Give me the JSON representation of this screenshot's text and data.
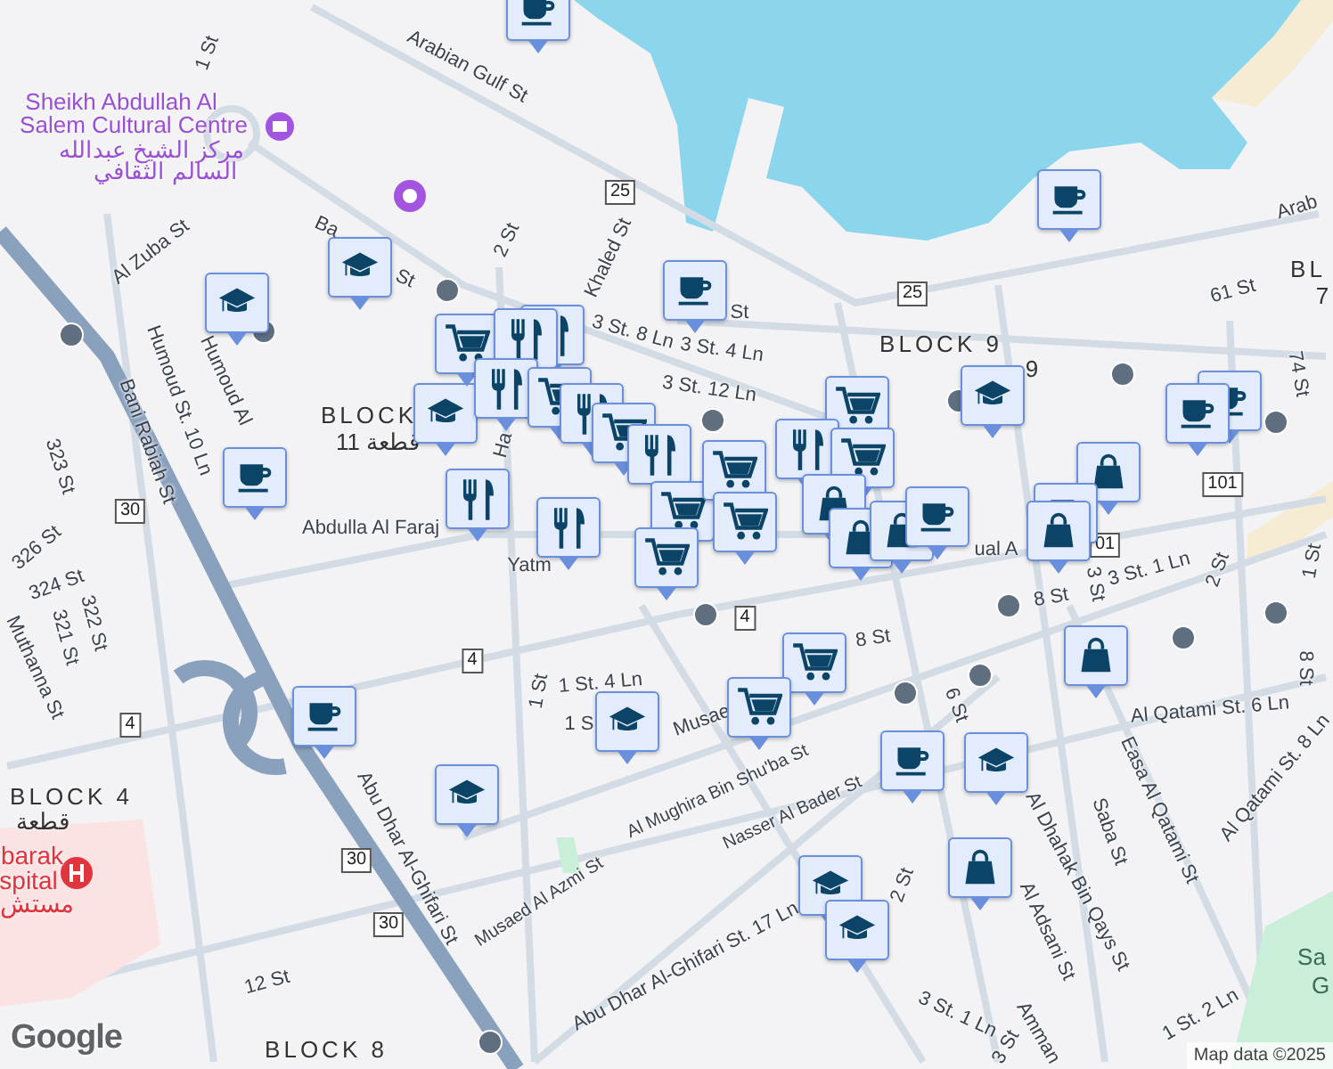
{
  "map": {
    "labels": [
      {
        "text": "Arabian Gulf St",
        "kind": "street"
      },
      {
        "text": "Arab",
        "kind": "street"
      },
      {
        "text": "Sheikh Abdullah Al",
        "kind": "poi"
      },
      {
        "text": "Salem Cultural Centre",
        "kind": "poi"
      },
      {
        "text": "مركز الشيخ عبدالله",
        "kind": "poi"
      },
      {
        "text": "السالم الثقافي",
        "kind": "poi"
      },
      {
        "text": "1 St",
        "kind": "street"
      },
      {
        "text": "25",
        "kind": "shield"
      },
      {
        "text": "2 St",
        "kind": "street"
      },
      {
        "text": "Khaled St",
        "kind": "street"
      },
      {
        "text": "Ba",
        "kind": "street"
      },
      {
        "text": "St",
        "kind": "street"
      },
      {
        "text": "Al Zuba St",
        "kind": "street"
      },
      {
        "text": "Humoud St. 10 Ln",
        "kind": "street"
      },
      {
        "text": "Humoud Al",
        "kind": "street"
      },
      {
        "text": "Bani Rabiah St",
        "kind": "street"
      },
      {
        "text": "323 St",
        "kind": "street"
      },
      {
        "text": "30",
        "kind": "shield"
      },
      {
        "text": "BLOCK",
        "kind": "area"
      },
      {
        "text": "قطعة 11",
        "kind": "area"
      },
      {
        "text": "3 St. 8 Ln",
        "kind": "street"
      },
      {
        "text": "St",
        "kind": "street"
      },
      {
        "text": "3 St. 4 Ln",
        "kind": "street"
      },
      {
        "text": "3 St. 12 Ln",
        "kind": "street"
      },
      {
        "text": "25",
        "kind": "shield"
      },
      {
        "text": "BLOCK 9",
        "kind": "area"
      },
      {
        "text": "9",
        "kind": "area"
      },
      {
        "text": "61 St",
        "kind": "street"
      },
      {
        "text": "BL",
        "kind": "area"
      },
      {
        "text": "7",
        "kind": "area"
      },
      {
        "text": "74 St",
        "kind": "street"
      },
      {
        "text": "101",
        "kind": "shield"
      },
      {
        "text": "01",
        "kind": "shield"
      },
      {
        "text": "Abdulla Al Faraj",
        "kind": "street"
      },
      {
        "text": "Ha",
        "kind": "street"
      },
      {
        "text": "Yatm",
        "kind": "street"
      },
      {
        "text": "ual A",
        "kind": "street"
      },
      {
        "text": "326 St",
        "kind": "street"
      },
      {
        "text": "324 St",
        "kind": "street"
      },
      {
        "text": "322 St",
        "kind": "street"
      },
      {
        "text": "321 St",
        "kind": "street"
      },
      {
        "text": "Muthanna St",
        "kind": "street"
      },
      {
        "text": "4",
        "kind": "shield"
      },
      {
        "text": "4",
        "kind": "shield"
      },
      {
        "text": "4",
        "kind": "shield"
      },
      {
        "text": "1 St",
        "kind": "street"
      },
      {
        "text": "1 St. 4 Ln",
        "kind": "street"
      },
      {
        "text": "1 S",
        "kind": "street"
      },
      {
        "text": "Musae",
        "kind": "street"
      },
      {
        "text": "BLOCK 4",
        "kind": "area"
      },
      {
        "text": "قطعة",
        "kind": "area"
      },
      {
        "text": "barak",
        "kind": "hospital"
      },
      {
        "text": "spital",
        "kind": "hospital"
      },
      {
        "text": "مستش",
        "kind": "hospital"
      },
      {
        "text": "Abu Dhar Al-Ghifari St",
        "kind": "street"
      },
      {
        "text": "Musaed Al Azmi St",
        "kind": "street"
      },
      {
        "text": "Al Mughira Bin Shu'ba St",
        "kind": "street"
      },
      {
        "text": "Nasser Al Bader St",
        "kind": "street"
      },
      {
        "text": "8 St",
        "kind": "street"
      },
      {
        "text": "8 St",
        "kind": "street"
      },
      {
        "text": "3 St",
        "kind": "street"
      },
      {
        "text": "3 St. 1 Ln",
        "kind": "street"
      },
      {
        "text": "2 St",
        "kind": "street"
      },
      {
        "text": "1 St",
        "kind": "street"
      },
      {
        "text": "Al Qatami St. 6 Ln",
        "kind": "street"
      },
      {
        "text": "Easa Al Qatami St",
        "kind": "street"
      },
      {
        "text": "Al Qatami St. 8 Ln",
        "kind": "street"
      },
      {
        "text": "8 St",
        "kind": "street"
      },
      {
        "text": "Saba St",
        "kind": "street"
      },
      {
        "text": "Al Dhahak Bin Qays St",
        "kind": "street"
      },
      {
        "text": "Al Adsani St",
        "kind": "street"
      },
      {
        "text": "6 St",
        "kind": "street"
      },
      {
        "text": "2 St",
        "kind": "street"
      },
      {
        "text": "Abu Dhar Al-Ghifari St. 17 Ln",
        "kind": "street"
      },
      {
        "text": "3 St. 1 Ln",
        "kind": "street"
      },
      {
        "text": "3 St",
        "kind": "street"
      },
      {
        "text": "Amman",
        "kind": "street"
      },
      {
        "text": "1 St. 2 Ln",
        "kind": "street"
      },
      {
        "text": "12 St",
        "kind": "street"
      },
      {
        "text": "BLOCK 8",
        "kind": "area"
      },
      {
        "text": "30",
        "kind": "shield"
      },
      {
        "text": "30",
        "kind": "shield"
      },
      {
        "text": "Sa",
        "kind": "park"
      },
      {
        "text": "G",
        "kind": "park"
      }
    ],
    "markers": [
      {
        "kind": "cafe"
      },
      {
        "kind": "school"
      },
      {
        "kind": "school"
      },
      {
        "kind": "cafe"
      },
      {
        "kind": "school"
      },
      {
        "kind": "cafe"
      },
      {
        "kind": "cafe"
      },
      {
        "kind": "school"
      },
      {
        "kind": "restaurant"
      },
      {
        "kind": "cart"
      },
      {
        "kind": "restaurant"
      },
      {
        "kind": "restaurant"
      },
      {
        "kind": "cart"
      },
      {
        "kind": "restaurant"
      },
      {
        "kind": "cart"
      },
      {
        "kind": "restaurant"
      },
      {
        "kind": "restaurant"
      },
      {
        "kind": "restaurant"
      },
      {
        "kind": "cart"
      },
      {
        "kind": "cart"
      },
      {
        "kind": "cart"
      },
      {
        "kind": "cart"
      },
      {
        "kind": "cart"
      },
      {
        "kind": "restaurant"
      },
      {
        "kind": "cart"
      },
      {
        "kind": "bag"
      },
      {
        "kind": "bag"
      },
      {
        "kind": "bag"
      },
      {
        "kind": "cafe"
      },
      {
        "kind": "bag"
      },
      {
        "kind": "cafe"
      },
      {
        "kind": "cafe"
      },
      {
        "kind": "cafe"
      },
      {
        "kind": "bag"
      },
      {
        "kind": "cafe"
      },
      {
        "kind": "school"
      },
      {
        "kind": "school"
      },
      {
        "kind": "cart"
      },
      {
        "kind": "cart"
      },
      {
        "kind": "bag"
      },
      {
        "kind": "cafe"
      },
      {
        "kind": "school"
      },
      {
        "kind": "school"
      },
      {
        "kind": "school"
      },
      {
        "kind": "bag"
      }
    ],
    "attribution": {
      "logo": "Google",
      "copyright": "Map data ©2025"
    }
  }
}
